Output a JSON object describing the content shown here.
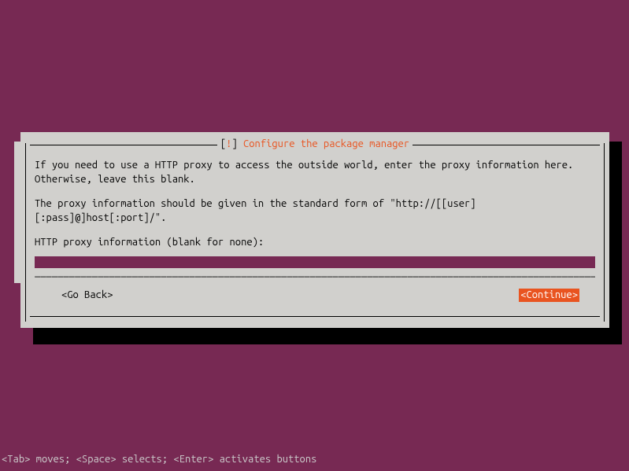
{
  "dialog": {
    "title_prefix": "[",
    "title_bang": "!",
    "title_suffix": "]",
    "title_text": "Configure the package manager",
    "para1": "If you need to use a HTTP proxy to access the outside world, enter the proxy information here. Otherwise, leave this blank.",
    "para2": "The proxy information should be given in the standard form of \"http://[[user][:pass]@]host[:port]/\".",
    "prompt": "HTTP proxy information (blank for none):",
    "input_value": "",
    "underline": "________________________________________________________________________________________________________________________",
    "go_back": "<Go Back>",
    "continue": "<Continue>"
  },
  "footer": {
    "help": "<Tab> moves; <Space> selects; <Enter> activates buttons"
  }
}
